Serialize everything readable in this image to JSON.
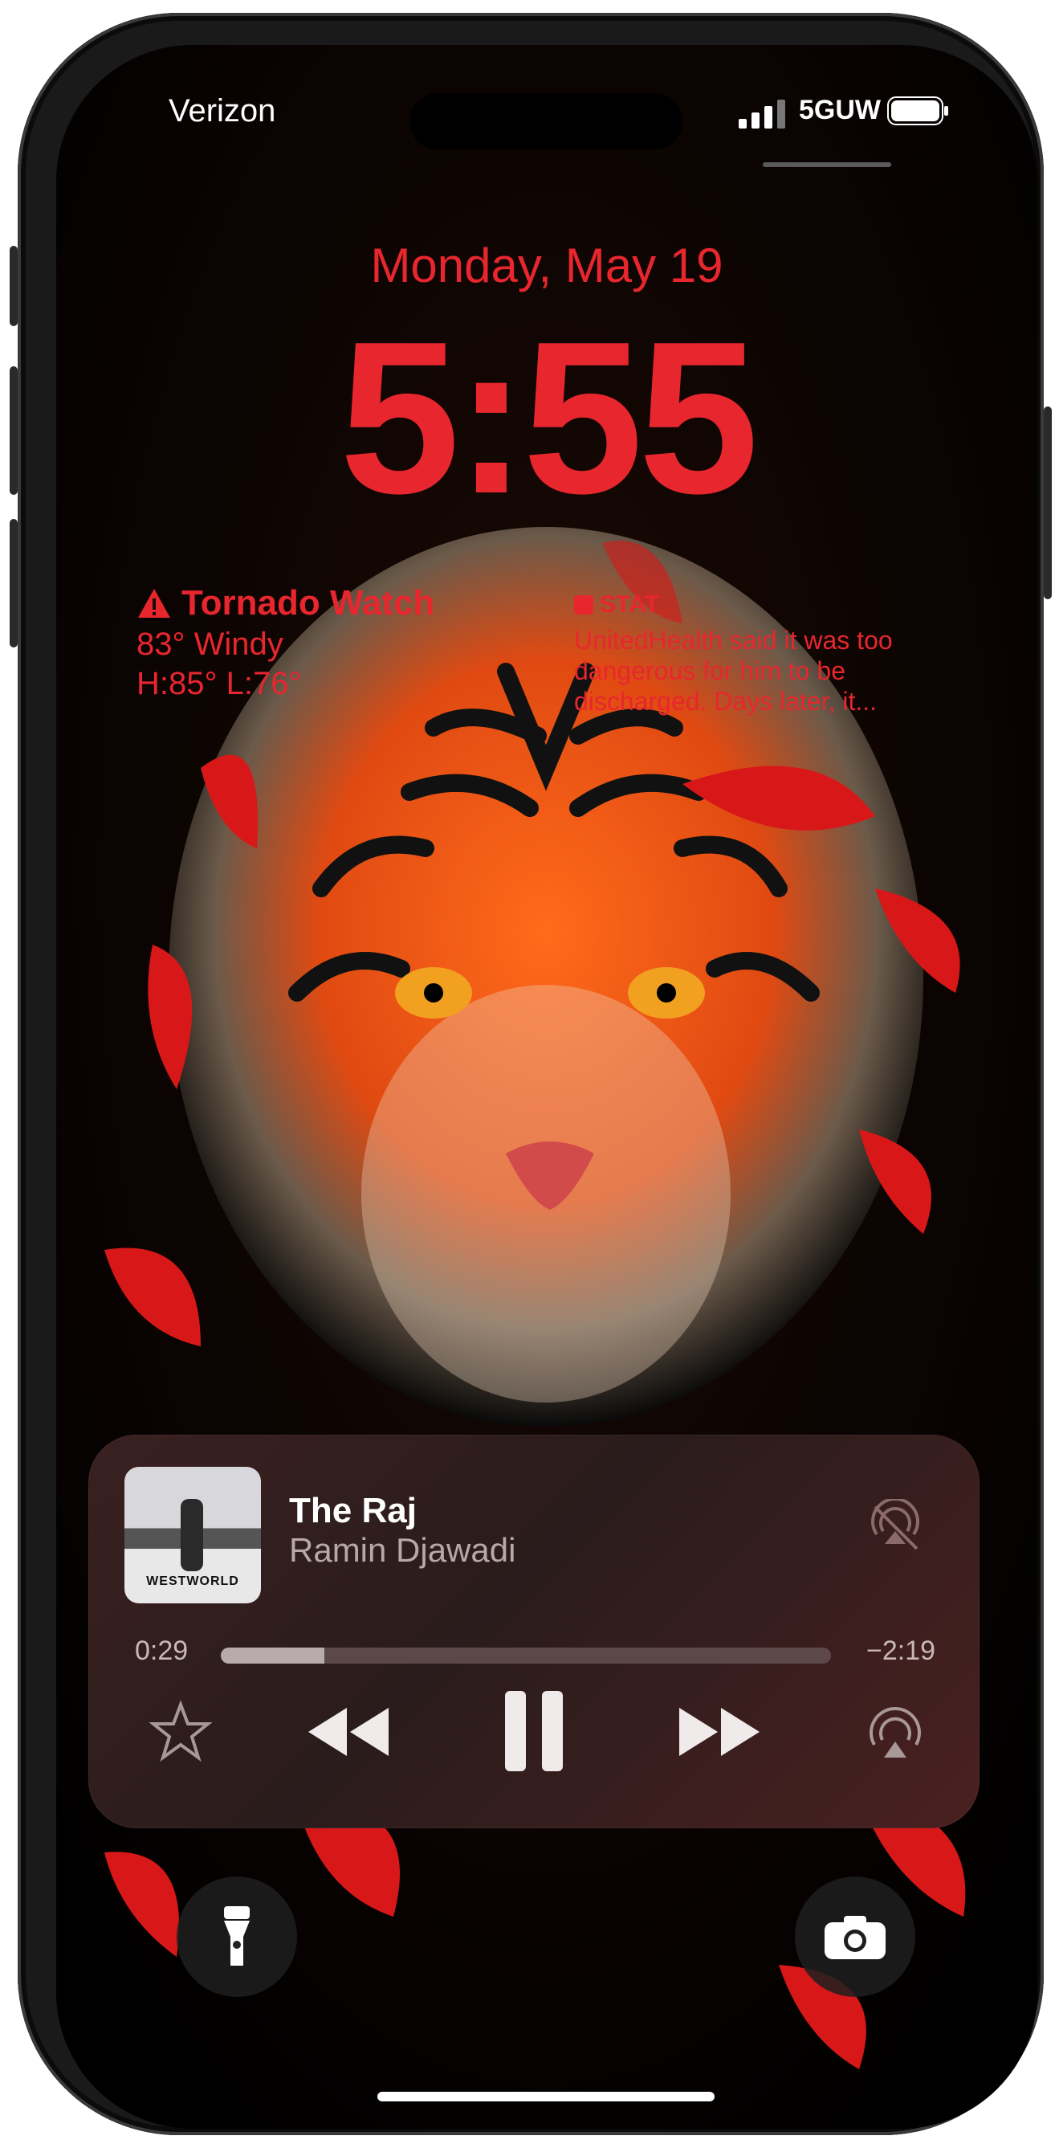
{
  "status_bar": {
    "carrier": "Verizon",
    "network": "5GUW"
  },
  "lock_screen": {
    "date": "Monday, May 19",
    "time": "5:55"
  },
  "widgets": {
    "weather": {
      "title": "Tornado Watch",
      "line1": "83° Windy",
      "line2": "H:85° L:76°"
    },
    "news": {
      "source": "STAT",
      "headline": "UnitedHealth said it was too dangerous for him to be discharged. Days later, it..."
    }
  },
  "now_playing": {
    "album_title": "WESTWORLD",
    "track": "The Raj",
    "artist": "Ramin Djawadi",
    "elapsed": "0:29",
    "remaining": "−2:19",
    "progress": 0.17
  },
  "icons": [
    "warning-icon",
    "news-icon",
    "signal-icon",
    "battery-icon",
    "airplay-off-icon",
    "star-icon",
    "rewind-icon",
    "pause-icon",
    "forward-icon",
    "airplay-icon",
    "flashlight-icon",
    "camera-icon"
  ],
  "colors": {
    "accent": "#e8262e",
    "player_bg": "#2a1c1c"
  }
}
